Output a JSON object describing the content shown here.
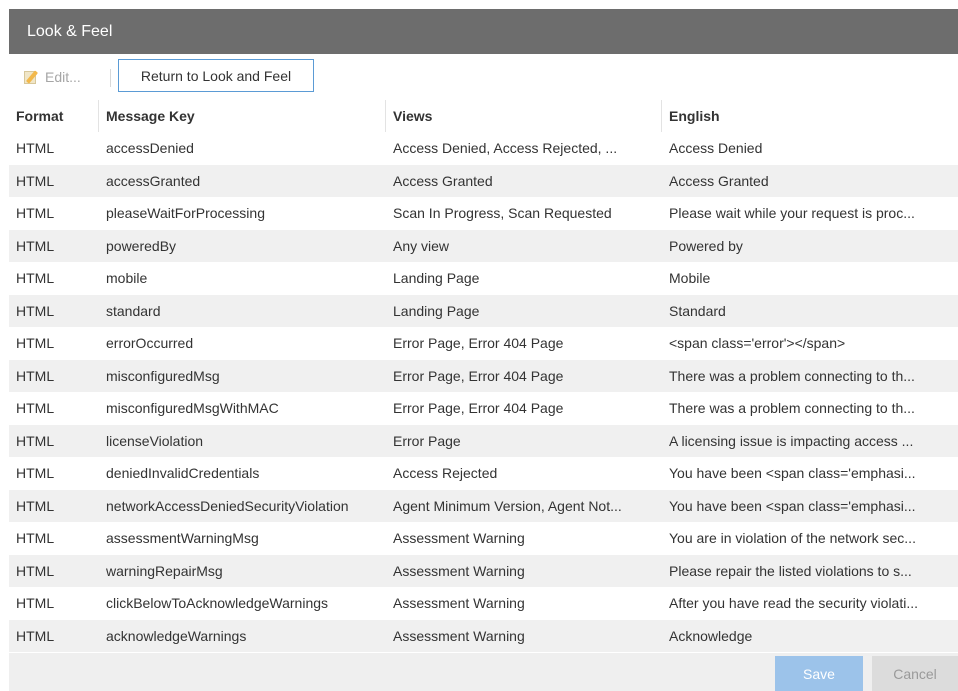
{
  "window": {
    "title": "Look & Feel"
  },
  "toolbar": {
    "edit_label": "Edit...",
    "return_label": "Return to Look and Feel"
  },
  "table": {
    "columns": [
      "Format",
      "Message Key",
      "Views",
      "English"
    ],
    "rows": [
      {
        "format": "HTML",
        "key": "accessDenied",
        "views": "Access Denied, Access Rejected, ...",
        "english": "Access Denied"
      },
      {
        "format": "HTML",
        "key": "accessGranted",
        "views": "Access Granted",
        "english": "Access Granted"
      },
      {
        "format": "HTML",
        "key": "pleaseWaitForProcessing",
        "views": "Scan In Progress, Scan Requested",
        "english": "Please wait while your request is proc..."
      },
      {
        "format": "HTML",
        "key": "poweredBy",
        "views": "Any view",
        "english": "Powered by"
      },
      {
        "format": "HTML",
        "key": "mobile",
        "views": "Landing Page",
        "english": "Mobile"
      },
      {
        "format": "HTML",
        "key": "standard",
        "views": "Landing Page",
        "english": "Standard"
      },
      {
        "format": "HTML",
        "key": "errorOccurred",
        "views": "Error Page, Error 404 Page",
        "english": "<span class='error'></span>"
      },
      {
        "format": "HTML",
        "key": "misconfiguredMsg",
        "views": "Error Page, Error 404 Page",
        "english": "There was a problem connecting to th..."
      },
      {
        "format": "HTML",
        "key": "misconfiguredMsgWithMAC",
        "views": "Error Page, Error 404 Page",
        "english": "There was a problem connecting to th..."
      },
      {
        "format": "HTML",
        "key": "licenseViolation",
        "views": "Error Page",
        "english": "A licensing issue is impacting access ..."
      },
      {
        "format": "HTML",
        "key": "deniedInvalidCredentials",
        "views": "Access Rejected",
        "english": "You have been <span class='emphasi..."
      },
      {
        "format": "HTML",
        "key": "networkAccessDeniedSecurityViolation",
        "views": "Agent Minimum Version, Agent Not...",
        "english": "You have been <span class='emphasi..."
      },
      {
        "format": "HTML",
        "key": "assessmentWarningMsg",
        "views": "Assessment Warning",
        "english": "You are in violation of the network sec..."
      },
      {
        "format": "HTML",
        "key": "warningRepairMsg",
        "views": "Assessment Warning",
        "english": "Please repair the listed violations to s..."
      },
      {
        "format": "HTML",
        "key": "clickBelowToAcknowledgeWarnings",
        "views": "Assessment Warning",
        "english": "After you have read the security violati..."
      },
      {
        "format": "HTML",
        "key": "acknowledgeWarnings",
        "views": "Assessment Warning",
        "english": "Acknowledge"
      }
    ]
  },
  "footer": {
    "save_label": "Save",
    "cancel_label": "Cancel"
  }
}
